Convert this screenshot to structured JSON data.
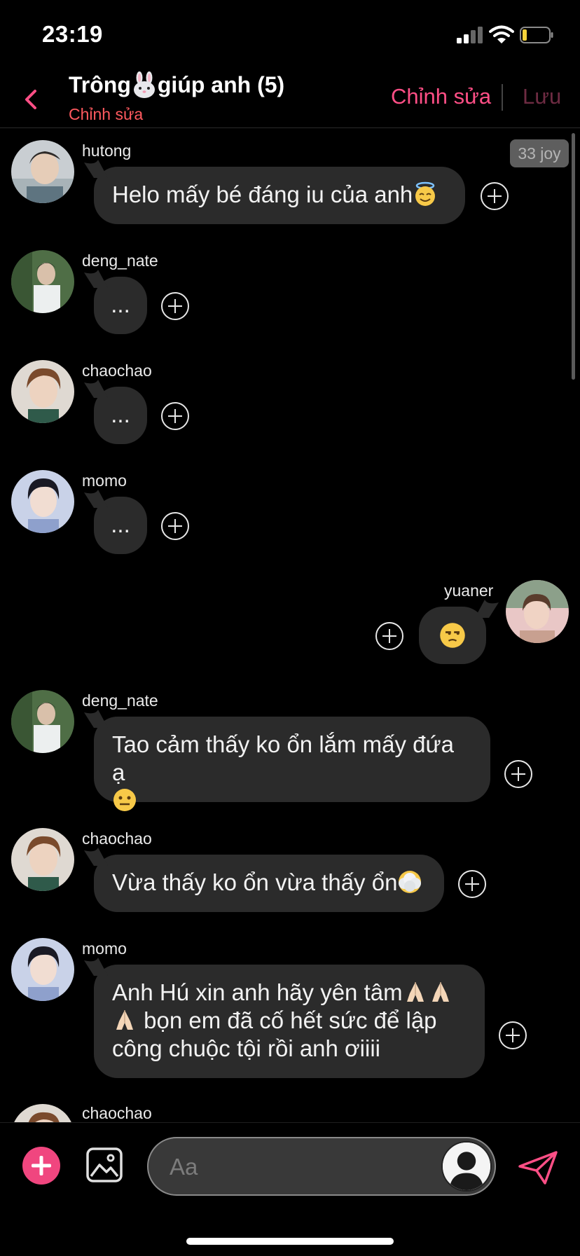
{
  "status": {
    "time": "23:19"
  },
  "header": {
    "title_part1": "Trông",
    "title_part2": "giúp anh (5)",
    "subtitle": "Chỉnh sửa",
    "edit_label": "Chỉnh sửa",
    "save_label": "Lưu",
    "badge": "33 joy"
  },
  "messages": [
    {
      "user": "hutong",
      "text": "Helo mấy bé đáng iu của anh",
      "emoji": "smiling-face-with-halo"
    },
    {
      "user": "deng_nate",
      "text": "..."
    },
    {
      "user": "chaochao",
      "text": "..."
    },
    {
      "user": "momo",
      "text": "..."
    },
    {
      "user": "yuaner",
      "emoji": "unamused-face"
    },
    {
      "user": "deng_nate",
      "text": "Tao cảm thấy ko ổn lắm mấy đứa ạ",
      "emoji": "neutral-face"
    },
    {
      "user": "chaochao",
      "text": "Vừa thấy ko ổn vừa thấy ổn",
      "emoji": "face-exhaling"
    },
    {
      "user": "momo",
      "line1": "Anh Hú xin anh hãy yên tâm",
      "line2": "bọn em đã cố hết sức để lập",
      "line3": "công chuộc tội rồi anh ơiiii",
      "emoji": "folded-hands"
    },
    {
      "user": "chaochao"
    }
  ],
  "composer": {
    "placeholder": "Aa"
  },
  "colors": {
    "accent": "#ff4f86",
    "subtitle": "#ff5a5f",
    "bubble": "#2b2b2b",
    "add_button": "#f0467f"
  }
}
